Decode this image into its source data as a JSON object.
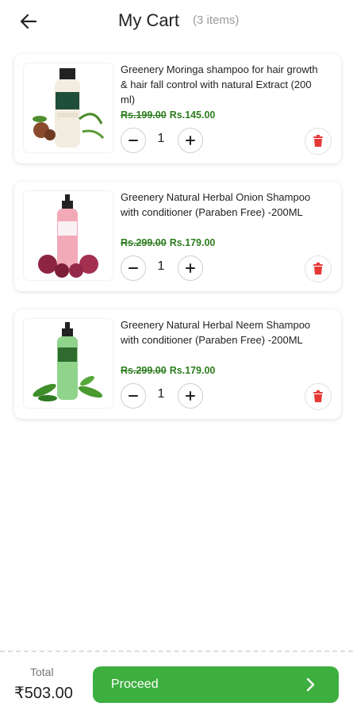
{
  "header": {
    "title": "My Cart",
    "item_count": "(3 items)",
    "back_icon": "arrow-left-icon"
  },
  "cart": {
    "items": [
      {
        "name": "Greenery Moringa shampoo for hair growth & hair fall control with natural Extract  (200 ml)",
        "old_price": "Rs.199.00",
        "price": "Rs.145.00",
        "quantity": "1"
      },
      {
        "name": "Greenery Natural Herbal Onion Shampoo with conditioner (Paraben Free) -200ML",
        "old_price": "Rs.299.00",
        "price": "Rs.179.00",
        "quantity": "1"
      },
      {
        "name": "Greenery Natural Herbal Neem Shampoo with conditioner (Paraben Free) -200ML",
        "old_price": "Rs.299.00",
        "price": "Rs.179.00",
        "quantity": "1"
      }
    ]
  },
  "footer": {
    "total_label": "Total",
    "total_value": "₹503.00",
    "proceed_label": "Proceed"
  },
  "colors": {
    "accent_green": "#3daf3f",
    "price_green": "#2e7d1f",
    "delete_red": "#e53935"
  }
}
